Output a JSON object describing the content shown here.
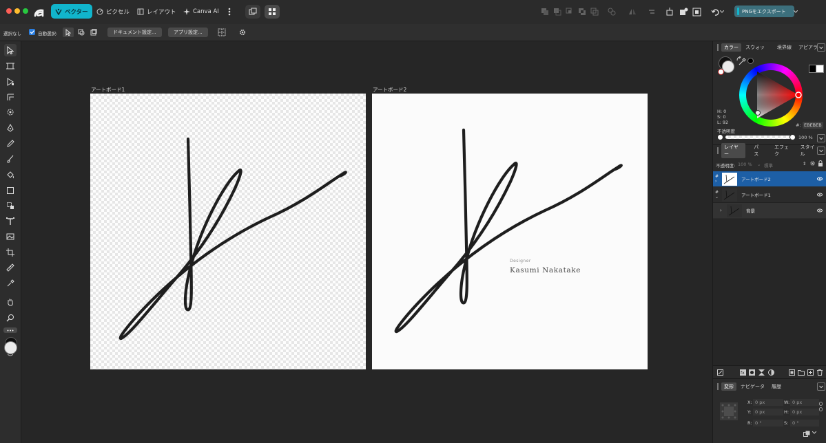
{
  "topbar": {
    "personas": [
      {
        "label": "ベクター"
      },
      {
        "label": "ピクセル"
      },
      {
        "label": "レイアウト"
      },
      {
        "label": "Canva AI"
      }
    ],
    "export_label": "PNGをエクスポート"
  },
  "context": {
    "selection_label": "選択なし",
    "auto_select_label": "自動選択:",
    "document_settings": "ドキュメント設定...",
    "app_settings": "アプリ設定..."
  },
  "canvas": {
    "artboard1_label": "アートボード1",
    "artboard2_label": "アートボード2",
    "designer_label": "Designer",
    "designer_name": "Kasumi Nakatake"
  },
  "color_panel": {
    "tabs": [
      "カラー",
      "スウォッ",
      "境界線",
      "アピアラ"
    ],
    "h_label": "H: 0",
    "s_label": "S: 0",
    "l_label": "L: 92",
    "hex_label": "#:",
    "hex_value": "EBEBEB",
    "opacity_label": "不透明度",
    "opacity_value": "100 %",
    "current_color": "#EBEBEB"
  },
  "layers_panel": {
    "tabs": [
      "レイヤー",
      "パス",
      "エフェク",
      "スタイル"
    ],
    "opacity_label": "不透明度:",
    "opacity_value": "100 %",
    "blend_mode": "標準",
    "layers": [
      {
        "name": "アートボード2",
        "selected": true
      },
      {
        "name": "アートボード1",
        "selected": false
      },
      {
        "name": "背景",
        "selected": false
      }
    ]
  },
  "transform_panel": {
    "tabs": [
      "変形",
      "ナビゲータ",
      "履歴"
    ],
    "x_label": "X:",
    "x_value": "0 px",
    "y_label": "Y:",
    "y_value": "0 px",
    "w_label": "W:",
    "w_value": "0 px",
    "h_label": "H:",
    "h_value": "0 px",
    "r_label": "R:",
    "r_value": "0 °",
    "s_label": "S:",
    "s_value": "0 °"
  },
  "colors": {
    "accent": "#11b5cc",
    "layer_selected": "#1d5fa6",
    "export_button": "#3c6f7c"
  }
}
